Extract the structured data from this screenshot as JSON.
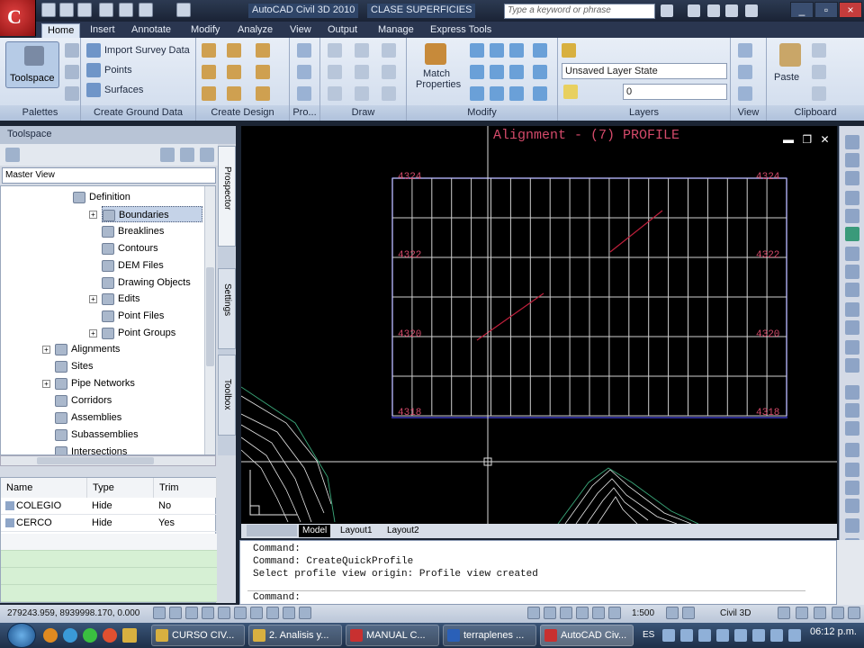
{
  "titlebar": {
    "app_title": "AutoCAD Civil 3D 2010",
    "file_title": "CLASE SUPERFICIES",
    "search_placeholder": "Type a keyword or phrase"
  },
  "ribbon": {
    "tabs": [
      "Home",
      "Insert",
      "Annotate",
      "Modify",
      "Analyze",
      "View",
      "Output",
      "Manage",
      "Express Tools"
    ],
    "panels": {
      "palettes": "Palettes",
      "create_ground": "Create Ground Data",
      "create_design": "Create Design",
      "profile": "Pro...",
      "draw": "Draw",
      "modify": "Modify",
      "layers": "Layers",
      "view": "View",
      "clipboard": "Clipboard"
    },
    "toolspace_btn": "Toolspace",
    "import_survey": "Import Survey Data",
    "points": "Points",
    "surfaces": "Surfaces",
    "match_props": "Match Properties",
    "layer_state": "Unsaved Layer State",
    "layer_value": "0",
    "paste": "Paste"
  },
  "toolspace": {
    "title": "Toolspace",
    "master_view": "Master View",
    "vertical_tabs": [
      "Prospector",
      "Settings",
      "Toolbox"
    ],
    "tree": [
      {
        "label": "Definition"
      },
      {
        "label": "Boundaries"
      },
      {
        "label": "Breaklines"
      },
      {
        "label": "Contours"
      },
      {
        "label": "DEM Files"
      },
      {
        "label": "Drawing Objects"
      },
      {
        "label": "Edits"
      },
      {
        "label": "Point Files"
      },
      {
        "label": "Point Groups"
      },
      {
        "label": "Alignments"
      },
      {
        "label": "Sites"
      },
      {
        "label": "Pipe Networks"
      },
      {
        "label": "Corridors"
      },
      {
        "label": "Assemblies"
      },
      {
        "label": "Subassemblies"
      },
      {
        "label": "Intersections"
      }
    ],
    "props_headers": [
      "Name",
      "Type",
      "Trim"
    ],
    "props_rows": [
      {
        "name": "COLEGIO",
        "type": "Hide",
        "trim": "No"
      },
      {
        "name": "CERCO",
        "type": "Hide",
        "trim": "Yes"
      }
    ]
  },
  "drawing": {
    "header": "Alignment - (7) PROFILE",
    "elev_labels": [
      "4324",
      "4322",
      "4320",
      "4318"
    ],
    "elev_labels_right": [
      "4324",
      "4322",
      "4320",
      "4318"
    ],
    "layout_tabs": [
      "Model",
      "Layout1",
      "Layout2"
    ]
  },
  "command": {
    "lines": [
      "Command:",
      "Command: CreateQuickProfile",
      "Select profile view origin: Profile view created",
      "",
      "Command:"
    ]
  },
  "status": {
    "coords": "279243.959, 8939998.170, 0.000",
    "scale": "1:500",
    "workspace": "Civil 3D"
  },
  "taskbar": {
    "items": [
      "CURSO CIV...",
      "2. Analisis y...",
      "MANUAL C...",
      "terraplenes ...",
      "AutoCAD Civ..."
    ],
    "lang": "ES",
    "clock": "06:12 p.m."
  }
}
